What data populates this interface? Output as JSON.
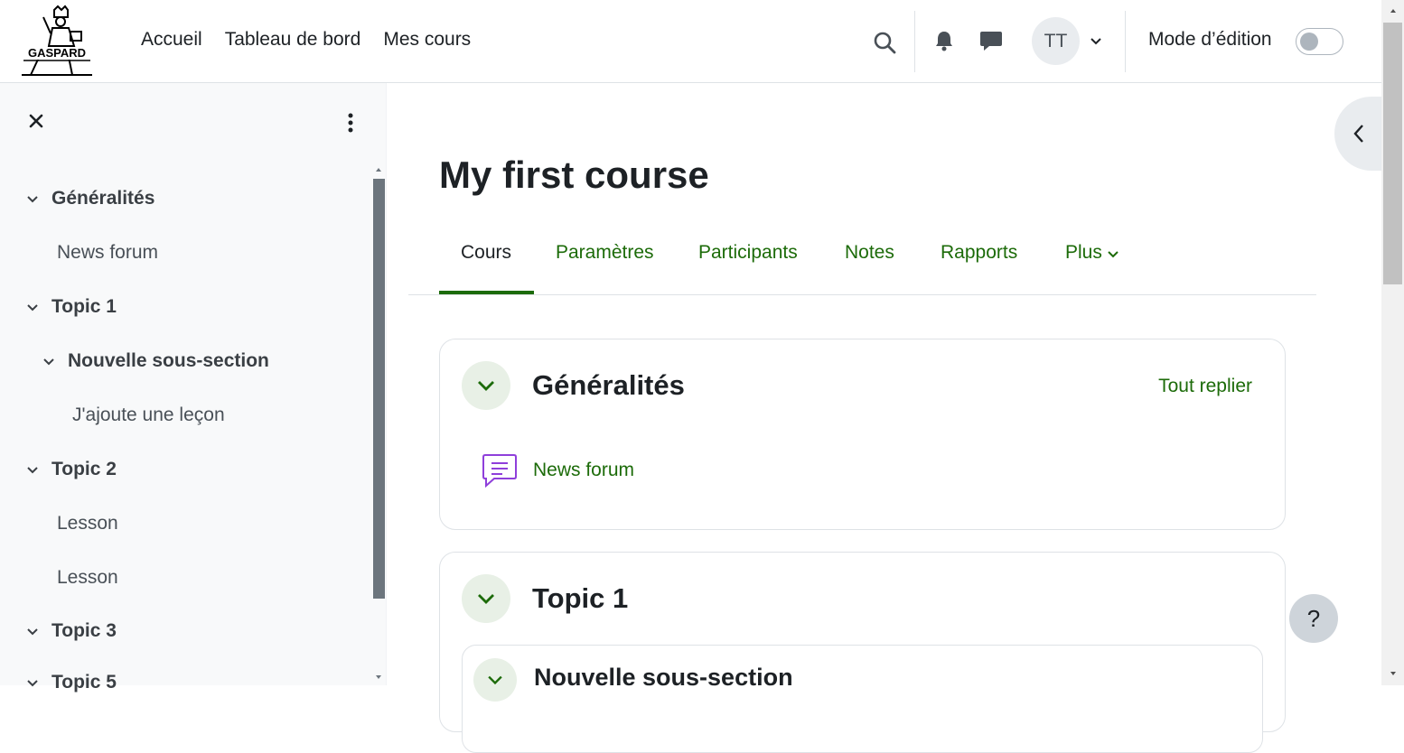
{
  "navbar": {
    "logo_text": "GASPARD",
    "links": [
      "Accueil",
      "Tableau de bord",
      "Mes cours"
    ],
    "user_initials": "TT",
    "edit_mode_label": "Mode d’édition",
    "edit_mode_on": false
  },
  "drawer": {
    "items": [
      {
        "label": "Généralités",
        "kind": "section"
      },
      {
        "label": "News forum",
        "kind": "activity"
      },
      {
        "label": "Topic 1",
        "kind": "section"
      },
      {
        "label": "Nouvelle sous-section",
        "kind": "subsection"
      },
      {
        "label": "J'ajoute une leçon",
        "kind": "activity"
      },
      {
        "label": "Topic 2",
        "kind": "section"
      },
      {
        "label": "Lesson",
        "kind": "activity"
      },
      {
        "label": "Lesson",
        "kind": "activity"
      },
      {
        "label": "Topic 3",
        "kind": "section"
      },
      {
        "label": "Topic 5",
        "kind": "section"
      }
    ]
  },
  "main": {
    "title": "My first course",
    "tabs": [
      "Cours",
      "Paramètres",
      "Participants",
      "Notes",
      "Rapports",
      "Plus"
    ],
    "active_tab": "Cours",
    "sections": [
      {
        "title": "Généralités",
        "collapse_all": "Tout replier",
        "activities": [
          "News forum"
        ]
      },
      {
        "title": "Topic 1",
        "subsection": "Nouvelle sous-section"
      }
    ]
  },
  "help_label": "?",
  "colors": {
    "accent": "#1c6b09",
    "forum_icon": "#8f3fdb"
  }
}
